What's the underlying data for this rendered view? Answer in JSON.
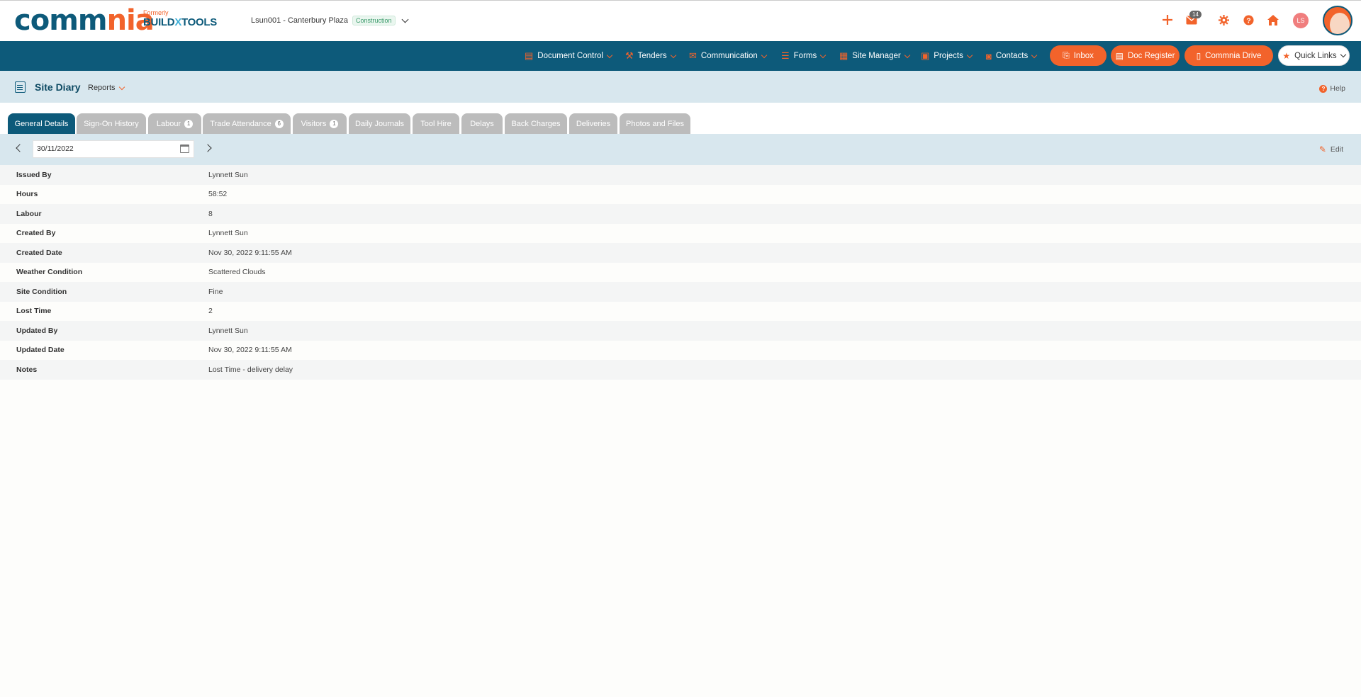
{
  "brand": {
    "logo_part1": "comm",
    "logo_part2": "nia",
    "formerly": "Formerly",
    "old_brand_1": "BUILD",
    "old_brand_x": "X",
    "old_brand_2": "TOOLS"
  },
  "project": {
    "name": "Lsun001 - Canterbury Plaza",
    "tag": "Construction"
  },
  "top_icons": {
    "messages_count": "14",
    "user_initials": "LS"
  },
  "nav": {
    "items": [
      {
        "label": "Document Control",
        "icon": "document-control-icon"
      },
      {
        "label": "Tenders",
        "icon": "hammer-icon"
      },
      {
        "label": "Communication",
        "icon": "envelope-icon"
      },
      {
        "label": "Forms",
        "icon": "forms-icon"
      },
      {
        "label": "Site Manager",
        "icon": "site-manager-icon"
      },
      {
        "label": "Projects",
        "icon": "projects-icon"
      },
      {
        "label": "Contacts",
        "icon": "contacts-icon"
      }
    ],
    "pills": {
      "inbox": "Inbox",
      "doc_register": "Doc Register",
      "commnia_drive": "Commnia Drive",
      "quick_links": "Quick Links"
    }
  },
  "page": {
    "title": "Site Diary",
    "reports": "Reports",
    "help": "Help"
  },
  "tabs": [
    {
      "label": "General Details",
      "count": ""
    },
    {
      "label": "Sign-On History",
      "count": ""
    },
    {
      "label": "Labour",
      "count": "1"
    },
    {
      "label": "Trade Attendance",
      "count": "6"
    },
    {
      "label": "Visitors",
      "count": "1"
    },
    {
      "label": "Daily Journals",
      "count": ""
    },
    {
      "label": "Tool Hire",
      "count": ""
    },
    {
      "label": "Delays",
      "count": ""
    },
    {
      "label": "Back Charges",
      "count": ""
    },
    {
      "label": "Deliveries",
      "count": ""
    },
    {
      "label": "Photos and Files",
      "count": ""
    }
  ],
  "datebar": {
    "date": "30/11/2022",
    "edit": "Edit"
  },
  "details": [
    {
      "label": "Issued By",
      "value": "Lynnett Sun"
    },
    {
      "label": "Hours",
      "value": "58:52"
    },
    {
      "label": "Labour",
      "value": "8"
    },
    {
      "label": "Created By",
      "value": "Lynnett Sun"
    },
    {
      "label": "Created Date",
      "value": "Nov 30, 2022 9:11:55 AM"
    },
    {
      "label": "Weather Condition",
      "value": "Scattered Clouds"
    },
    {
      "label": "Site Condition",
      "value": "Fine"
    },
    {
      "label": "Lost Time",
      "value": "2"
    },
    {
      "label": "Updated By",
      "value": "Lynnett Sun"
    },
    {
      "label": "Updated Date",
      "value": "Nov 30, 2022 9:11:55 AM"
    },
    {
      "label": "Notes",
      "value": "Lost Time - delivery delay"
    }
  ],
  "colors": {
    "brand_blue": "#0d5a7a",
    "brand_orange": "#f2632b",
    "tab_inactive": "#bcbcbc",
    "header_bg": "#d8e7ee"
  }
}
